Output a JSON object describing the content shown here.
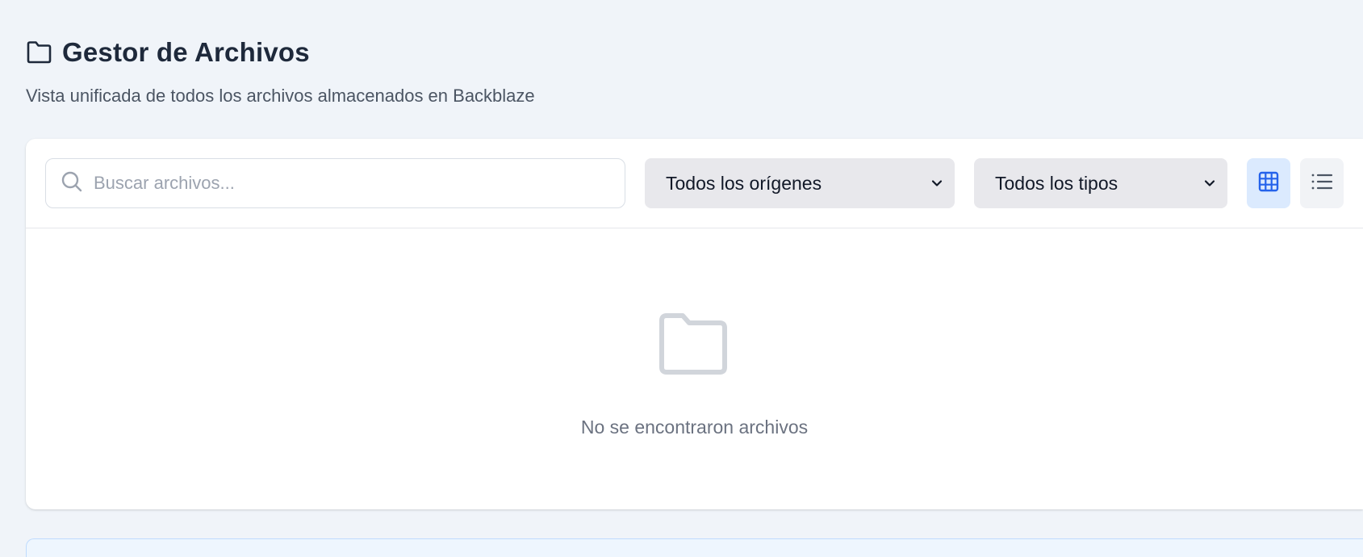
{
  "header": {
    "title": "Gestor de Archivos",
    "subtitle": "Vista unificada de todos los archivos almacenados en Backblaze",
    "icon": "folder-icon"
  },
  "toolbar": {
    "search": {
      "placeholder": "Buscar archivos...",
      "value": "",
      "icon": "search-icon"
    },
    "origin_filter": {
      "selected": "Todos los orígenes"
    },
    "type_filter": {
      "selected": "Todos los tipos"
    },
    "view_toggle": {
      "active": "grid",
      "grid_icon": "grid-icon",
      "list_icon": "list-icon"
    }
  },
  "empty_state": {
    "icon": "folder-icon",
    "message": "No se encontraron archivos"
  },
  "colors": {
    "background": "#f0f4f9",
    "accent": "#2563eb",
    "active_toggle_bg": "#dbeafe"
  }
}
